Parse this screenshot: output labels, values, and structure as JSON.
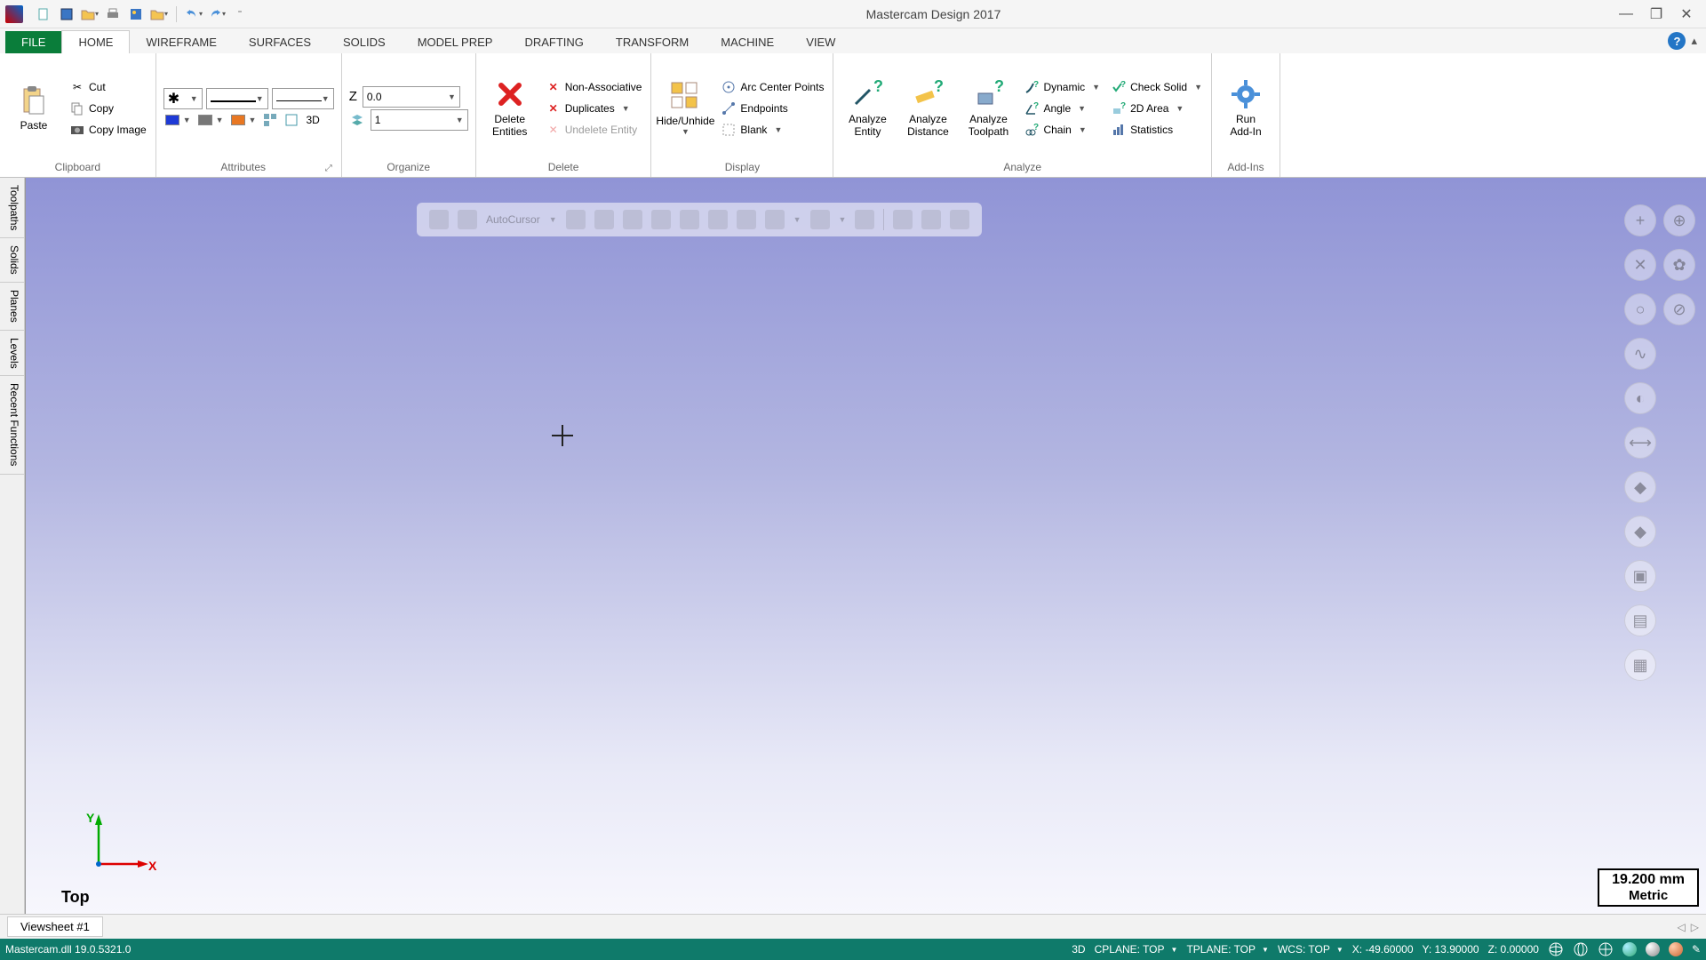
{
  "app": {
    "title": "Mastercam Design 2017"
  },
  "tabs": {
    "file": "FILE",
    "items": [
      "HOME",
      "WIREFRAME",
      "SURFACES",
      "SOLIDS",
      "MODEL PREP",
      "DRAFTING",
      "TRANSFORM",
      "MACHINE",
      "VIEW"
    ],
    "active": 0
  },
  "ribbon": {
    "clipboard": {
      "label": "Clipboard",
      "paste": "Paste",
      "cut": "Cut",
      "copy": "Copy",
      "copy_image": "Copy Image"
    },
    "attributes": {
      "label": "Attributes",
      "three_d": "3D"
    },
    "organize": {
      "label": "Organize",
      "z_label": "Z",
      "z_value": "0.0",
      "level_value": "1"
    },
    "delete": {
      "label": "Delete",
      "delete_entities": "Delete\nEntities",
      "non_assoc": "Non-Associative",
      "duplicates": "Duplicates",
      "undelete": "Undelete Entity"
    },
    "display": {
      "label": "Display",
      "hide_unhide": "Hide/Unhide",
      "arc_center": "Arc Center Points",
      "endpoints": "Endpoints",
      "blank": "Blank"
    },
    "analyze": {
      "label": "Analyze",
      "entity": "Analyze\nEntity",
      "distance": "Analyze\nDistance",
      "toolpath": "Analyze\nToolpath",
      "dynamic": "Dynamic",
      "angle": "Angle",
      "chain": "Chain",
      "check_solid": "Check Solid",
      "two_d_area": "2D Area",
      "statistics": "Statistics"
    },
    "addins": {
      "label": "Add-Ins",
      "run": "Run\nAdd-In"
    }
  },
  "side_tabs": [
    "Toolpaths",
    "Solids",
    "Planes",
    "Levels",
    "Recent Functions"
  ],
  "float_toolbar": {
    "autocursor": "AutoCursor"
  },
  "canvas": {
    "view_label": "Top",
    "axis_x": "X",
    "axis_y": "Y",
    "scale_value": "19.200 mm",
    "scale_unit": "Metric"
  },
  "viewsheet": {
    "tab": "Viewsheet #1"
  },
  "status": {
    "dll": "Mastercam.dll 19.0.5321.0",
    "mode": "3D",
    "cplane": "CPLANE: TOP",
    "tplane": "TPLANE: TOP",
    "wcs": "WCS: TOP",
    "x": "X: -49.60000",
    "y": "Y: 13.90000",
    "z": "Z: 0.00000"
  }
}
